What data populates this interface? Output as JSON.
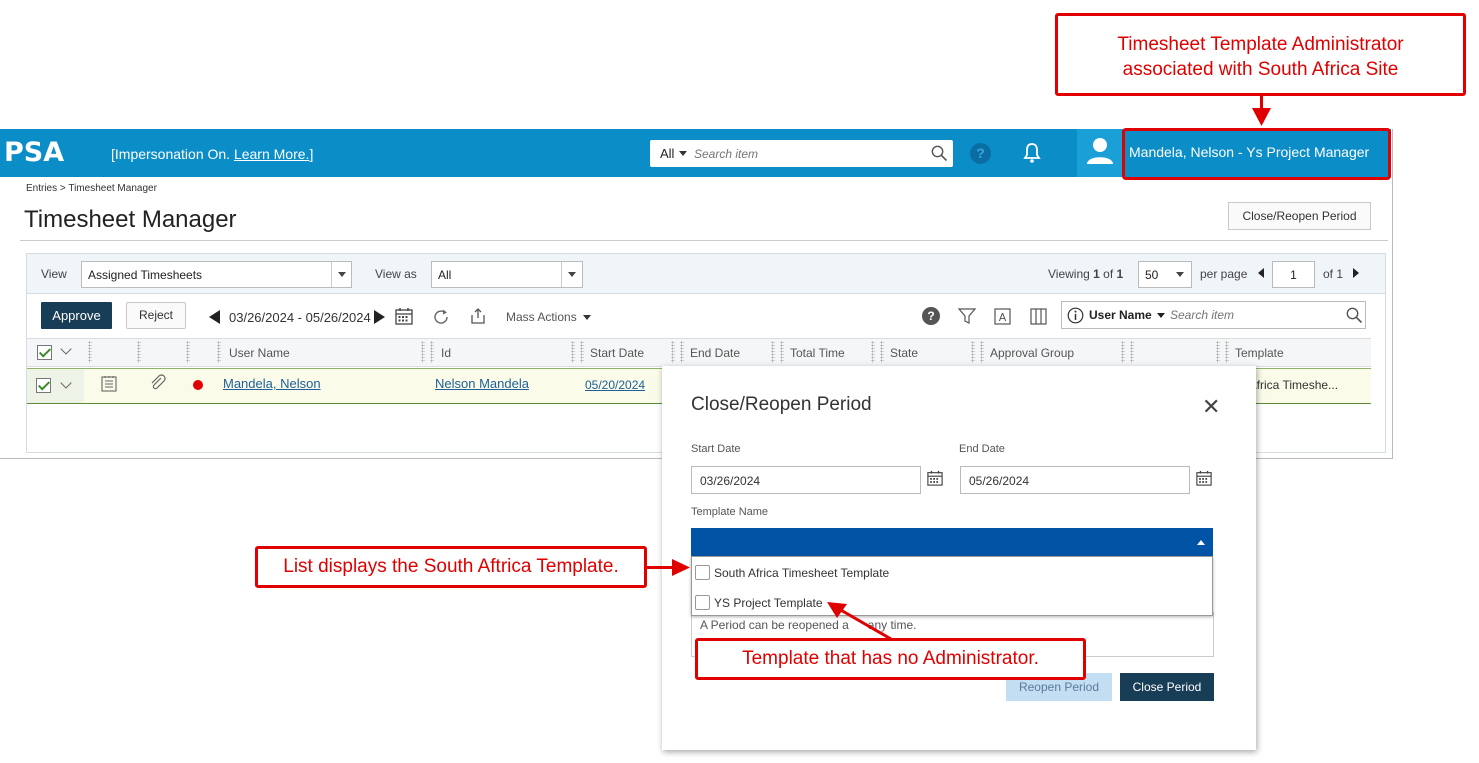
{
  "callouts": {
    "top_right_line1": "Timesheet Template Administrator",
    "top_right_line2": "associated with South Africa Site",
    "left": "List displays the South Aftrica Template.",
    "bottom": "Template that has no Administrator."
  },
  "topbar": {
    "logo": "PSA",
    "impersonation": "[Impersonation On. ",
    "learn_more": "Learn More.",
    "impersonation_end": "]",
    "search_scope": "All",
    "search_placeholder": "Search item",
    "user": "Mandela, Nelson - Ys Project Manager"
  },
  "page": {
    "breadcrumb": "Entries > Timesheet Manager",
    "title": "Timesheet Manager",
    "close_reopen_button": "Close/Reopen Period"
  },
  "filters": {
    "view_label": "View",
    "view_value": "Assigned Timesheets",
    "view_as_label": "View as",
    "view_as_value": "All",
    "viewing_prefix": "Viewing ",
    "viewing_page": "1",
    "viewing_of": " of ",
    "viewing_total": "1",
    "per_page_value": "50",
    "per_page_label": "per page",
    "page_input": "1",
    "of_pages": "of 1"
  },
  "toolbar": {
    "approve": "Approve",
    "reject": "Reject",
    "date_range": "03/26/2024 - 05/26/2024",
    "mass_actions": "Mass Actions",
    "search_field": "User Name",
    "search_placeholder": "Search item"
  },
  "columns": [
    "User Name",
    "Id",
    "Start Date",
    "End Date",
    "Total Time",
    "State",
    "Approval Group",
    "Template"
  ],
  "row": {
    "user_name": "Mandela, Nelson",
    "id": "Nelson Mandela",
    "start_date": "05/20/2024",
    "template": "th Africa Timeshe..."
  },
  "dialog": {
    "title": "Close/Reopen Period",
    "start_label": "Start Date",
    "start_value": "03/26/2024",
    "end_label": "End Date",
    "end_value": "05/26/2024",
    "template_label": "Template Name",
    "options": [
      "South Africa Timesheet Template",
      "YS Project Template"
    ],
    "note_prefix": "A Period can be reopened a",
    "note_suffix": "any time.",
    "reopen_button": "Reopen Period",
    "close_button": "Close Period"
  },
  "colors": {
    "brand_blue": "#0b8dc8",
    "dark_navy": "#183d56",
    "callout_red": "#e00000",
    "select_blue": "#0153a6"
  }
}
